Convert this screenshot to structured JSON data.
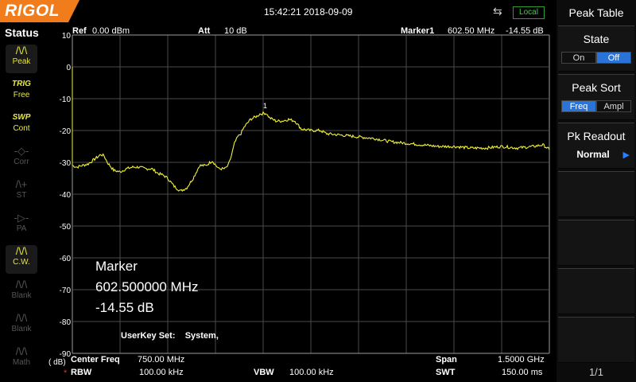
{
  "brand": "RIGOL",
  "clock": "15:42:21 2018-09-09",
  "remote_state": "Local",
  "status": {
    "title": "Status",
    "items": [
      {
        "top": "Peak",
        "glyph": "/\\/\\",
        "state": "on"
      },
      {
        "top": "TRIG",
        "sub": "Free",
        "state": "green"
      },
      {
        "top": "SWP",
        "sub": "Cont",
        "state": "green"
      },
      {
        "top": "Corr",
        "glyph": "-◇-",
        "state": "dim"
      },
      {
        "top": "ST",
        "glyph": "/\\+",
        "state": "dim"
      },
      {
        "top": "PA",
        "glyph": "-▷-",
        "state": "dim"
      },
      {
        "top": "C.W.",
        "glyph": "/\\/\\",
        "state": "on"
      },
      {
        "top": "Blank",
        "glyph": "/\\/\\",
        "state": "dim"
      },
      {
        "top": "Blank",
        "glyph": "/\\/\\",
        "state": "dim"
      },
      {
        "top": "Math",
        "glyph": "/\\/\\",
        "state": "dim"
      }
    ]
  },
  "header": {
    "ref_label": "Ref",
    "ref_value": "0.00 dBm",
    "att_label": "Att",
    "att_value": "10 dB",
    "marker_label": "Marker1",
    "marker_freq": "602.50 MHz",
    "marker_ampl": "-14.55 dB"
  },
  "axis": {
    "unit": "( dB)",
    "y_ticks": [
      "10",
      "0",
      "-10",
      "-20",
      "-30",
      "-40",
      "-50",
      "-60",
      "-70",
      "-80",
      "-90"
    ]
  },
  "marker_info": {
    "title": "Marker",
    "freq": "602.500000 MHz",
    "ampl": "-14.55 dB",
    "marker_number": "1"
  },
  "userkey": "UserKey Set:    System,",
  "footer": {
    "center_label": "Center Freq",
    "center_value": "750.00 MHz",
    "span_label": "Span",
    "span_value": "1.5000 GHz",
    "rbw_label": "RBW",
    "rbw_value": "100.00 kHz",
    "vbw_label": "VBW",
    "vbw_value": "100.00 kHz",
    "swt_label": "SWT",
    "swt_value": "150.00 ms",
    "rbw_star": "*"
  },
  "softkeys": {
    "title": "Peak Table",
    "state": {
      "label": "State",
      "on": "On",
      "off": "Off",
      "selected": "Off"
    },
    "sort": {
      "label": "Peak Sort",
      "freq": "Freq",
      "ampl": "Ampl",
      "selected": "Freq"
    },
    "readout": {
      "label": "Pk Readout",
      "value": "Normal"
    },
    "page": "1/1"
  },
  "colors": {
    "trace": "#f2f23a",
    "grid": "#4a4a4a",
    "brand": "#f07c1c",
    "select": "#2a74d8"
  },
  "chart_data": {
    "type": "line",
    "xlabel": "",
    "ylabel": "",
    "xlim": [
      0,
      1500
    ],
    "ylim": [
      -90,
      10
    ],
    "grid": true,
    "series": [
      {
        "x": [
          0,
          15,
          30,
          50,
          70,
          90,
          100,
          110,
          130,
          150,
          170,
          190,
          210,
          230,
          250,
          270,
          285,
          300,
          320,
          340,
          360,
          380,
          400,
          420,
          440,
          460,
          480,
          490,
          500,
          510,
          520,
          530,
          540,
          560,
          580,
          590,
          600,
          605,
          610,
          620,
          630,
          640,
          660,
          680,
          700,
          720,
          750,
          780,
          800,
          850,
          900,
          950,
          1000,
          1050,
          1100,
          1150,
          1200,
          1250,
          1300,
          1350,
          1400,
          1450,
          1480,
          1500
        ],
        "y": [
          -31,
          -31.5,
          -31,
          -30.5,
          -29,
          -27.5,
          -28,
          -30,
          -32.5,
          -33,
          -32,
          -31.5,
          -31.5,
          -32,
          -32,
          -33.5,
          -34,
          -35,
          -37.5,
          -39,
          -38,
          -35,
          -31,
          -31,
          -29.5,
          -32,
          -32,
          -31,
          -28,
          -24,
          -22,
          -21,
          -19,
          -16.5,
          -15.5,
          -14.8,
          -14.6,
          -14.55,
          -14.7,
          -16,
          -16.5,
          -17,
          -17,
          -16.5,
          -17,
          -19.5,
          -20,
          -20,
          -21,
          -21.5,
          -22,
          -22.5,
          -23.5,
          -24,
          -24.5,
          -25,
          -25,
          -25.5,
          -25.5,
          -25,
          -25.5,
          -25,
          -24.5,
          -26
        ]
      }
    ]
  }
}
